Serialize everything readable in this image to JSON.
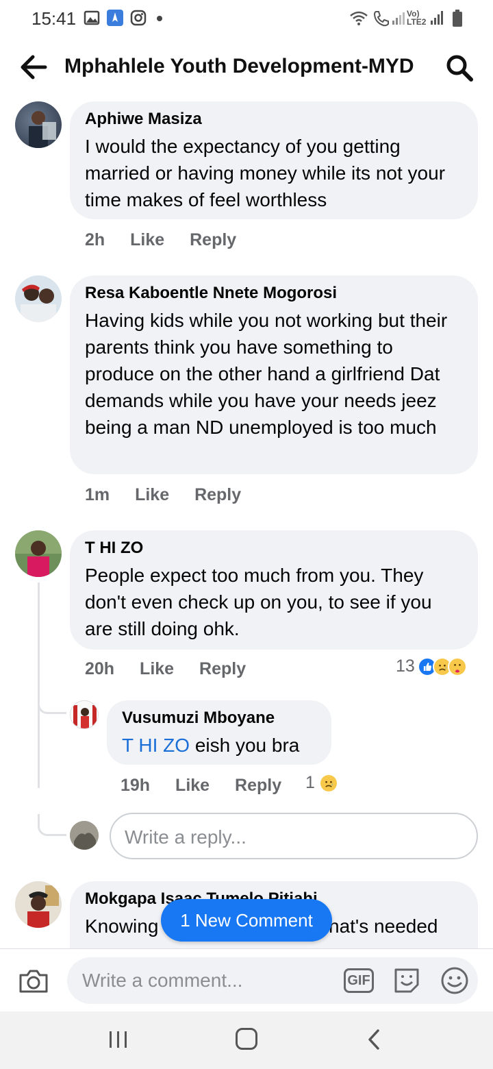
{
  "status_bar": {
    "time": "15:41",
    "network_label": "Vo) LTE2",
    "icons": [
      "gallery-icon",
      "app-icon",
      "instagram-icon",
      "dot-icon",
      "wifi-icon",
      "call-icon",
      "signal-icon",
      "battery-icon"
    ]
  },
  "header": {
    "title": "Mphahlele Youth Development-MYD",
    "back_icon": "arrow-left-icon",
    "search_icon": "search-icon"
  },
  "comments": [
    {
      "author": "Aphiwe Masiza",
      "text": "I would the expectancy of you getting married or having money while its not your time makes of feel worthless",
      "time": "2h",
      "like": "Like",
      "reply": "Reply"
    },
    {
      "author": "Resa Kaboentle Nnete Mogorosi",
      "text": "Having kids while you not working but their parents think you have something to produce on the other hand a girlfriend Dat demands while you have your needs jeez being a man ND unemployed is too much",
      "time": "1m",
      "like": "Like",
      "reply": "Reply"
    },
    {
      "author": "T HI ZO",
      "text": "People expect too much from you. They don't even check up on you, to see if you are still doing ohk.",
      "time": "20h",
      "like": "Like",
      "reply": "Reply",
      "reaction_count": "13"
    },
    {
      "author": "Mokgapa Isaac Tumelo Pitjahi",
      "text_visible": "Knowing",
      "text_visible_end": "hat's needed"
    }
  ],
  "reply": {
    "author": "Vusumuzi Mboyane",
    "mention": "T HI ZO",
    "text": " eish you bra",
    "time": "19h",
    "like": "Like",
    "reply": "Reply",
    "reaction_count": "1"
  },
  "reply_input": {
    "placeholder": "Write a reply..."
  },
  "new_comment_pill": "1 New Comment",
  "composer": {
    "placeholder": "Write a comment...",
    "gif_label": "GIF"
  },
  "colors": {
    "bubble": "#f0f2f5",
    "accent": "#1877f2",
    "mention": "#1a6ed8",
    "secondary_text": "#65676b"
  }
}
